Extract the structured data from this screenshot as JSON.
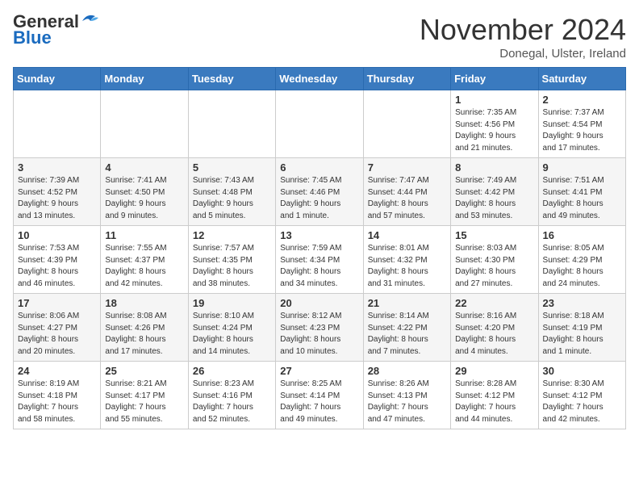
{
  "header": {
    "logo_general": "General",
    "logo_blue": "Blue",
    "month_title": "November 2024",
    "location": "Donegal, Ulster, Ireland"
  },
  "weekdays": [
    "Sunday",
    "Monday",
    "Tuesday",
    "Wednesday",
    "Thursday",
    "Friday",
    "Saturday"
  ],
  "weeks": [
    [
      {
        "day": "",
        "info": ""
      },
      {
        "day": "",
        "info": ""
      },
      {
        "day": "",
        "info": ""
      },
      {
        "day": "",
        "info": ""
      },
      {
        "day": "",
        "info": ""
      },
      {
        "day": "1",
        "info": "Sunrise: 7:35 AM\nSunset: 4:56 PM\nDaylight: 9 hours\nand 21 minutes."
      },
      {
        "day": "2",
        "info": "Sunrise: 7:37 AM\nSunset: 4:54 PM\nDaylight: 9 hours\nand 17 minutes."
      }
    ],
    [
      {
        "day": "3",
        "info": "Sunrise: 7:39 AM\nSunset: 4:52 PM\nDaylight: 9 hours\nand 13 minutes."
      },
      {
        "day": "4",
        "info": "Sunrise: 7:41 AM\nSunset: 4:50 PM\nDaylight: 9 hours\nand 9 minutes."
      },
      {
        "day": "5",
        "info": "Sunrise: 7:43 AM\nSunset: 4:48 PM\nDaylight: 9 hours\nand 5 minutes."
      },
      {
        "day": "6",
        "info": "Sunrise: 7:45 AM\nSunset: 4:46 PM\nDaylight: 9 hours\nand 1 minute."
      },
      {
        "day": "7",
        "info": "Sunrise: 7:47 AM\nSunset: 4:44 PM\nDaylight: 8 hours\nand 57 minutes."
      },
      {
        "day": "8",
        "info": "Sunrise: 7:49 AM\nSunset: 4:42 PM\nDaylight: 8 hours\nand 53 minutes."
      },
      {
        "day": "9",
        "info": "Sunrise: 7:51 AM\nSunset: 4:41 PM\nDaylight: 8 hours\nand 49 minutes."
      }
    ],
    [
      {
        "day": "10",
        "info": "Sunrise: 7:53 AM\nSunset: 4:39 PM\nDaylight: 8 hours\nand 46 minutes."
      },
      {
        "day": "11",
        "info": "Sunrise: 7:55 AM\nSunset: 4:37 PM\nDaylight: 8 hours\nand 42 minutes."
      },
      {
        "day": "12",
        "info": "Sunrise: 7:57 AM\nSunset: 4:35 PM\nDaylight: 8 hours\nand 38 minutes."
      },
      {
        "day": "13",
        "info": "Sunrise: 7:59 AM\nSunset: 4:34 PM\nDaylight: 8 hours\nand 34 minutes."
      },
      {
        "day": "14",
        "info": "Sunrise: 8:01 AM\nSunset: 4:32 PM\nDaylight: 8 hours\nand 31 minutes."
      },
      {
        "day": "15",
        "info": "Sunrise: 8:03 AM\nSunset: 4:30 PM\nDaylight: 8 hours\nand 27 minutes."
      },
      {
        "day": "16",
        "info": "Sunrise: 8:05 AM\nSunset: 4:29 PM\nDaylight: 8 hours\nand 24 minutes."
      }
    ],
    [
      {
        "day": "17",
        "info": "Sunrise: 8:06 AM\nSunset: 4:27 PM\nDaylight: 8 hours\nand 20 minutes."
      },
      {
        "day": "18",
        "info": "Sunrise: 8:08 AM\nSunset: 4:26 PM\nDaylight: 8 hours\nand 17 minutes."
      },
      {
        "day": "19",
        "info": "Sunrise: 8:10 AM\nSunset: 4:24 PM\nDaylight: 8 hours\nand 14 minutes."
      },
      {
        "day": "20",
        "info": "Sunrise: 8:12 AM\nSunset: 4:23 PM\nDaylight: 8 hours\nand 10 minutes."
      },
      {
        "day": "21",
        "info": "Sunrise: 8:14 AM\nSunset: 4:22 PM\nDaylight: 8 hours\nand 7 minutes."
      },
      {
        "day": "22",
        "info": "Sunrise: 8:16 AM\nSunset: 4:20 PM\nDaylight: 8 hours\nand 4 minutes."
      },
      {
        "day": "23",
        "info": "Sunrise: 8:18 AM\nSunset: 4:19 PM\nDaylight: 8 hours\nand 1 minute."
      }
    ],
    [
      {
        "day": "24",
        "info": "Sunrise: 8:19 AM\nSunset: 4:18 PM\nDaylight: 7 hours\nand 58 minutes."
      },
      {
        "day": "25",
        "info": "Sunrise: 8:21 AM\nSunset: 4:17 PM\nDaylight: 7 hours\nand 55 minutes."
      },
      {
        "day": "26",
        "info": "Sunrise: 8:23 AM\nSunset: 4:16 PM\nDaylight: 7 hours\nand 52 minutes."
      },
      {
        "day": "27",
        "info": "Sunrise: 8:25 AM\nSunset: 4:14 PM\nDaylight: 7 hours\nand 49 minutes."
      },
      {
        "day": "28",
        "info": "Sunrise: 8:26 AM\nSunset: 4:13 PM\nDaylight: 7 hours\nand 47 minutes."
      },
      {
        "day": "29",
        "info": "Sunrise: 8:28 AM\nSunset: 4:12 PM\nDaylight: 7 hours\nand 44 minutes."
      },
      {
        "day": "30",
        "info": "Sunrise: 8:30 AM\nSunset: 4:12 PM\nDaylight: 7 hours\nand 42 minutes."
      }
    ]
  ]
}
